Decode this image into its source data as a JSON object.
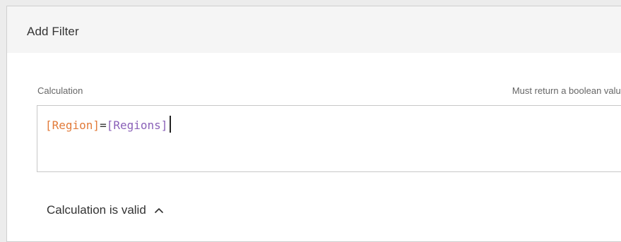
{
  "dialog": {
    "title": "Add Filter"
  },
  "calculation": {
    "label": "Calculation",
    "hint": "Must return a boolean value",
    "tokens": [
      {
        "text": "[Region]",
        "kind": "field",
        "color": "#e27b3a"
      },
      {
        "text": "=",
        "kind": "operator",
        "color": "#333333"
      },
      {
        "text": "[Regions]",
        "kind": "field",
        "color": "#8a61b8"
      }
    ]
  },
  "status": {
    "text": "Calculation is valid",
    "icon": "chevron-up-icon"
  }
}
